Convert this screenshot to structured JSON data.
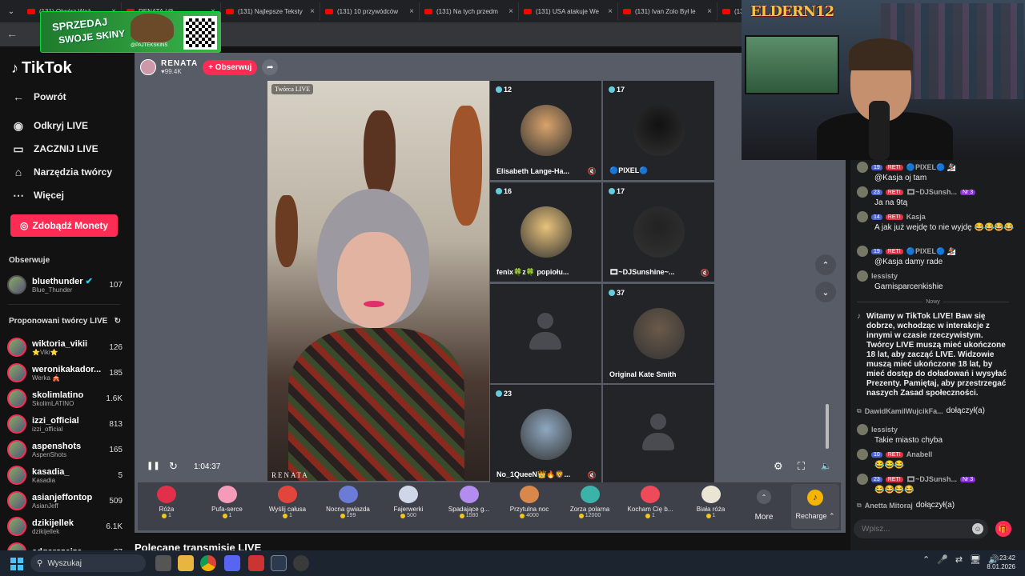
{
  "browser": {
    "menu_glyph": "⌄",
    "tabs": [
      {
        "label": "(131) Otwórz Wąż"
      },
      {
        "label": "RENATA (@..."
      },
      {
        "label": "(131) Najlepsze Teksty"
      },
      {
        "label": "(131) 10 przywódców"
      },
      {
        "label": "(131) Na tych przedm"
      },
      {
        "label": "(131) USA atakuje We"
      },
      {
        "label": "(131) Ivan Zolo Był le"
      },
      {
        "label": "(131"
      }
    ],
    "back_glyph": "←"
  },
  "promo": {
    "line1": "SPRZEDAJ",
    "line2": "SWOJE SKINY",
    "handle": "@PAJTEKSKINS"
  },
  "webcam": {
    "logo_text": "ELDERN12"
  },
  "sidebar": {
    "logo": "TikTok",
    "back": "Powrót",
    "nav": [
      {
        "label": "Odkryj LIVE",
        "icon": "live-discover-icon"
      },
      {
        "label": "ZACZNIJ LIVE",
        "icon": "camera-icon"
      },
      {
        "label": "Narzędzia twórcy",
        "icon": "home-icon"
      },
      {
        "label": "Więcej",
        "icon": "more-icon"
      }
    ],
    "coins_label": "Zdobądź Monety",
    "following_title": "Obserwuje",
    "following": [
      {
        "name": "bluethunder",
        "sub": "Blue_Thunder",
        "count": "107",
        "verified": "✔"
      }
    ],
    "suggested_title": "Proponowani twórcy LIVE",
    "refresh_glyph": "↻",
    "suggested": [
      {
        "name": "wiktoria_vikii",
        "sub": "⭐Viki⭐",
        "count": "126"
      },
      {
        "name": "weronikakador...",
        "sub": "Werka 🎪",
        "count": "185"
      },
      {
        "name": "skolimlatino",
        "sub": "SkolimLATINO",
        "count": "1.6K"
      },
      {
        "name": "izzi_official",
        "sub": "izzi_official",
        "count": "813"
      },
      {
        "name": "aspenshots",
        "sub": "AspenShots",
        "count": "165"
      },
      {
        "name": "kasadia_",
        "sub": "Kasadia",
        "count": "5"
      },
      {
        "name": "asianjeffontop",
        "sub": "AsianJeff",
        "count": "509"
      },
      {
        "name": "dzikijellek",
        "sub": "dzikijellek",
        "count": "6.1K"
      },
      {
        "name": "edgarszeiza",
        "sub": "",
        "count": "37"
      }
    ]
  },
  "stream": {
    "host_name": "RENATA",
    "host_likes": "♥99.4K",
    "follow_label": "+ Obserwuj",
    "share_glyph": "➦",
    "creator_tag": "Twórca LIVE",
    "watermark": "RENATA",
    "elapsed": "1:04:37",
    "up_glyph": "⌃",
    "down_glyph": "⌄",
    "pause_glyph": "❚❚",
    "refresh_glyph": "↻",
    "settings_glyph": "⚙",
    "fullscreen_glyph": "⛶",
    "volume_glyph": "🔈",
    "guests": [
      {
        "count": "12",
        "name": "Elisabeth Lange-Ha...",
        "muted": true
      },
      {
        "count": "17",
        "name": "🔵PIXEL🔵",
        "muted": false
      },
      {
        "count": "16",
        "name": "fenix🍀z🍀 popiołu...",
        "muted": false
      },
      {
        "count": "17",
        "name": "🎞~DJSunshine~...",
        "muted": true
      },
      {
        "count": "",
        "name": "",
        "muted": false
      },
      {
        "count": "37",
        "name": "Original Kate Smith",
        "muted": false
      },
      {
        "count": "23",
        "name": "No_1QueeN👑🔥🦁...",
        "muted": true
      },
      {
        "count": "",
        "name": "",
        "muted": false
      }
    ],
    "mute_glyph": "🔇"
  },
  "gifts": {
    "items": [
      {
        "label": "Róża",
        "price": "1"
      },
      {
        "label": "Pufa-serce",
        "price": "1"
      },
      {
        "label": "Wyślij całusa",
        "price": "1"
      },
      {
        "label": "Nocna gwiazda",
        "price": "199"
      },
      {
        "label": "Fajerwerki",
        "price": "500"
      },
      {
        "label": "Spadające g...",
        "price": "1580"
      },
      {
        "label": "Przytulna noc",
        "price": "4000"
      },
      {
        "label": "Zorza polarna",
        "price": "12000"
      },
      {
        "label": "Kocham Cię b...",
        "price": "1"
      },
      {
        "label": "Biała róża",
        "price": "1"
      }
    ],
    "more_label": "More",
    "recharge_label": "Recharge ⌃",
    "below_title": "Polecane transmisje LIVE"
  },
  "chat": {
    "messages": [
      {
        "level": "19",
        "fan": "RETI",
        "user": "🔵PIXEL🔵 🏂",
        "text": "@Kasja oj tam",
        "nr": ""
      },
      {
        "level": "23",
        "fan": "RETI",
        "user": "🎞~DJSunsh...",
        "text": "Ja na 9tą",
        "nr": "Nr 3"
      },
      {
        "level": "14",
        "fan": "RETI",
        "user": "Kasja",
        "text": "A jak już wejdę to nie wyjdę 😂😂😂😂",
        "nr": ""
      },
      {
        "level": "19",
        "fan": "RETI",
        "user": "🔵PIXEL🔵 🏂",
        "text": "@Kasja damy rade",
        "nr": ""
      },
      {
        "level": "",
        "fan": "",
        "user": "lessisty",
        "text": "Garnisparcenkishie",
        "nr": ""
      }
    ],
    "new_label": "Nowy",
    "welcome": "Witamy w TikTok LIVE! Baw się dobrze, wchodząc w interakcje z innymi w czasie rzeczywistym. Twórcy LIVE muszą mieć ukończone 18 lat, aby zacząć LIVE. Widzowie muszą mieć ukończone 18 lat, by mieć dostęp do doładowań i wysyłać Prezenty. Pamiętaj, aby przestrzegać naszych Zasad społeczności.",
    "after": [
      {
        "type": "join",
        "user": "DawidKamilWujcikFa...",
        "text": "dołączył(a)"
      },
      {
        "type": "msg",
        "level": "",
        "fan": "",
        "user": "lessisty",
        "text": "Takie miasto chyba",
        "nr": ""
      },
      {
        "type": "msg",
        "level": "10",
        "fan": "RETI",
        "user": "Anabell",
        "text": "😂😂😂",
        "nr": ""
      },
      {
        "type": "msg",
        "level": "23",
        "fan": "RETI",
        "user": "🎞~DJSunsh...",
        "text": "😂😂😂😂",
        "nr": "Nr 3"
      },
      {
        "type": "join",
        "user": "Anetta Mitoraj",
        "text": "dołączył(a)"
      }
    ],
    "input_placeholder": "Wpisz...",
    "emoji_glyph": "☺",
    "gift_glyph": "🎁"
  },
  "taskbar": {
    "search_placeholder": "Wyszukaj",
    "time": "23:42",
    "date": "8.01.2026",
    "tray_glyphs": [
      "⌃",
      "🎤",
      "⇄",
      "🖥",
      "🔊"
    ]
  }
}
